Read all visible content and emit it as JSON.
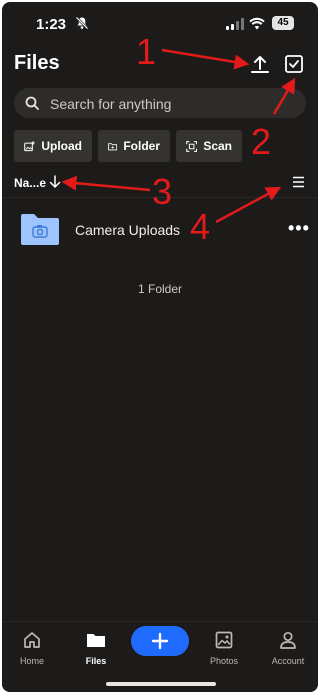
{
  "status_bar": {
    "time": "1:23",
    "battery": "45"
  },
  "header": {
    "title": "Files"
  },
  "search": {
    "placeholder": "Search for anything"
  },
  "actions": [
    {
      "label": "Upload",
      "icon": "add-image-icon"
    },
    {
      "label": "Folder",
      "icon": "add-folder-icon"
    },
    {
      "label": "Scan",
      "icon": "scan-icon"
    }
  ],
  "sort": {
    "label": "Na...e"
  },
  "files": [
    {
      "name": "Camera Uploads",
      "type": "folder",
      "menu": "•••"
    }
  ],
  "summary": {
    "count_text": "1 Folder"
  },
  "tabs": [
    {
      "label": "Home",
      "icon": "home-icon"
    },
    {
      "label": "Files",
      "icon": "folder-icon"
    },
    {
      "label": "Photos",
      "icon": "photos-icon"
    },
    {
      "label": "Account",
      "icon": "account-icon"
    }
  ],
  "annotations": [
    "1",
    "2",
    "3",
    "4"
  ],
  "colors": {
    "background": "#1c1b1a",
    "accent": "#1f6bff",
    "annotation": "#e21a1a",
    "folder": "#9dc4ff"
  }
}
